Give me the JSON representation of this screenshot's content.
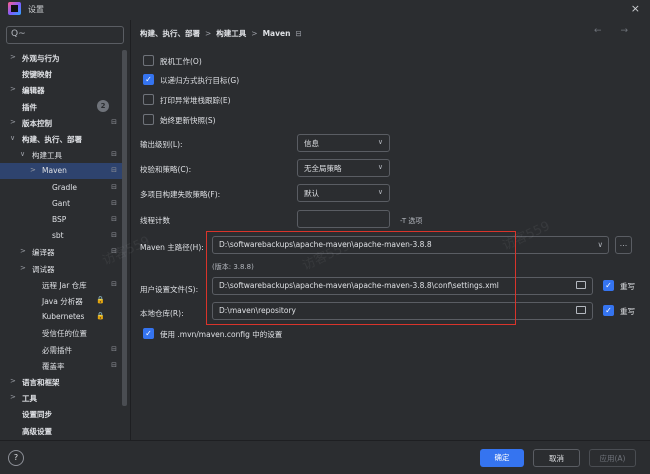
{
  "window": {
    "title": "设置",
    "close_glyph": "×"
  },
  "search": {
    "placeholder": "Q~"
  },
  "sidebar": {
    "items": [
      {
        "label": "外观与行为",
        "arrow": ">",
        "bold": true
      },
      {
        "label": "按键映射",
        "bold": true
      },
      {
        "label": "编辑器",
        "arrow": ">",
        "bold": true
      },
      {
        "label": "插件",
        "bold": true,
        "badge": "2"
      },
      {
        "label": "版本控制",
        "arrow": ">",
        "bold": true,
        "mark": "⊟"
      },
      {
        "label": "构建、执行、部署",
        "arrow": "∨",
        "bold": true
      },
      {
        "label": "构建工具",
        "arrow": "∨",
        "mark": "⊟"
      },
      {
        "label": "Maven",
        "arrow": ">",
        "mark": "⊟",
        "selected": true
      },
      {
        "label": "Gradle",
        "mark": "⊟"
      },
      {
        "label": "Gant",
        "mark": "⊟"
      },
      {
        "label": "BSP",
        "mark": "⊟"
      },
      {
        "label": "sbt",
        "mark": "⊟"
      },
      {
        "label": "编译器",
        "arrow": ">",
        "mark": "⊟"
      },
      {
        "label": "调试器",
        "arrow": ">"
      },
      {
        "label": "远程 Jar 仓库",
        "mark": "⊟"
      },
      {
        "label": "Java 分析器",
        "lock": "🔒"
      },
      {
        "label": "Kubernetes",
        "lock": "🔒"
      },
      {
        "label": "受信任的位置"
      },
      {
        "label": "必需插件",
        "mark": "⊟"
      },
      {
        "label": "覆盖率",
        "mark": "⊟"
      },
      {
        "label": "语言和框架",
        "arrow": ">",
        "bold": true
      },
      {
        "label": "工具",
        "arrow": ">",
        "bold": true
      },
      {
        "label": "设置同步",
        "bold": true
      },
      {
        "label": "高级设置",
        "bold": true
      }
    ]
  },
  "breadcrumb": {
    "part1": "构建、执行、部署",
    "sep": ">",
    "part2": "构建工具",
    "part3": "Maven",
    "icon": "⊟",
    "nav": "← →"
  },
  "checkboxes": [
    {
      "label": "脱机工作(O)",
      "checked": false
    },
    {
      "label": "以递归方式执行目标(G)",
      "checked": true
    },
    {
      "label": "打印异常堆栈跟踪(E)",
      "checked": false
    },
    {
      "label": "始终更新快照(S)",
      "checked": false
    }
  ],
  "fields": {
    "output_level": {
      "label": "输出级别(L):",
      "value": "信息"
    },
    "checksum_policy": {
      "label": "校验和策略(C):",
      "value": "无全局策略"
    },
    "multiproject_fail": {
      "label": "多项目构建失败策略(F):",
      "value": "默认"
    },
    "thread_count": {
      "label": "线程计数",
      "value": "",
      "hint": "-T 选项"
    },
    "maven_home": {
      "label": "Maven 主路径(H):",
      "value": "D:\\softwarebackups\\apache-maven\\apache-maven-3.8.8",
      "version": "(版本: 3.8.8)",
      "more": "..."
    },
    "user_settings": {
      "label": "用户设置文件(S):",
      "value": "D:\\softwarebackups\\apache-maven\\apache-maven-3.8.8\\conf\\settings.xml",
      "override": "重写"
    },
    "local_repo": {
      "label": "本地仓库(R):",
      "value": "D:\\maven\\repository",
      "override": "重写"
    },
    "use_mvn_config": {
      "label": "使用 .mvn/maven.config 中的设置",
      "checked": true
    }
  },
  "watermarks": [
    "访客559",
    "访客559",
    "访客559"
  ],
  "footer": {
    "help": "?",
    "ok": "确定",
    "cancel": "取消",
    "apply": "应用(A)"
  }
}
